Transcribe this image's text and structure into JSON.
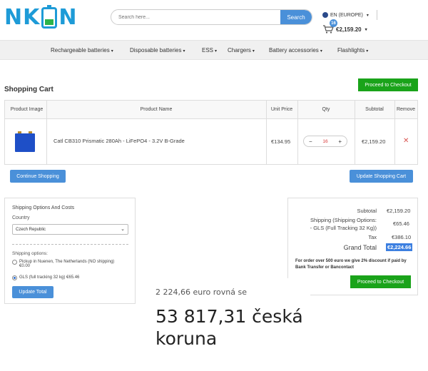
{
  "header": {
    "logo_text_left": "NK",
    "logo_text_right": "N",
    "search_placeholder": "Search here...",
    "search_button": "Search",
    "language": "EN (EUROPE)",
    "cart_count": "16",
    "cart_total": "€2,159.20"
  },
  "nav": {
    "items": [
      {
        "label": "Rechargeable batteries"
      },
      {
        "label": "Disposable batteries"
      },
      {
        "label": "ESS"
      },
      {
        "label": "Chargers"
      },
      {
        "label": "Battery accessories"
      },
      {
        "label": "Flashlights"
      }
    ]
  },
  "cart": {
    "title": "Shopping Cart",
    "checkout_button": "Proceed to Checkout",
    "columns": [
      "Product Image",
      "Product Name",
      "Unit Price",
      "Qty",
      "Subtotal",
      "Remove"
    ],
    "items": [
      {
        "name": "Catl CB310 Prismatic 280Ah - LiFePO4 - 3.2V B-Grade",
        "unit_price": "€134.95",
        "qty": "16",
        "subtotal": "€2,159.20"
      }
    ],
    "qty_minus": "−",
    "qty_plus": "+",
    "remove_symbol": "✕",
    "continue_button": "Continue Shopping",
    "update_button": "Update Shopping Cart"
  },
  "shipping": {
    "title": "Shipping Options And Costs",
    "country_label": "Country",
    "country_value": "Czech Republic",
    "options_label": "Shipping options:",
    "options": [
      {
        "label": "Pickup in Nuenen, The Netherlands (NO shipping)",
        "price": "€0.00",
        "selected": false
      },
      {
        "label": "GLS (full tracking 32 kg) €65.46",
        "price": "",
        "selected": true
      }
    ],
    "update_total_button": "Update Total"
  },
  "totals": {
    "subtotal_label": "Subtotal",
    "subtotal_value": "€2,159.20",
    "shipping_label_1": "Shipping (Shipping Options:",
    "shipping_label_2": "- GLS (Full Tracking 32 Kg))",
    "shipping_value": "€65.46",
    "tax_label": "Tax",
    "tax_value": "€386.10",
    "grand_label": "Grand Total",
    "grand_value": "€2,224.66",
    "discount_note": "For order over 500 euro we give 2% discount if paid by Bank Transfer or Bancontact",
    "checkout_button": "Proceed to Checkout"
  },
  "conversion": {
    "line1": "2 224,66 euro rovná se",
    "line2": "53 817,31 česká koruna"
  },
  "colors": {
    "brand_blue": "#1e9bd7",
    "button_blue": "#4a90d9",
    "checkout_green": "#1aa31a",
    "remove_red": "#d9534f"
  }
}
